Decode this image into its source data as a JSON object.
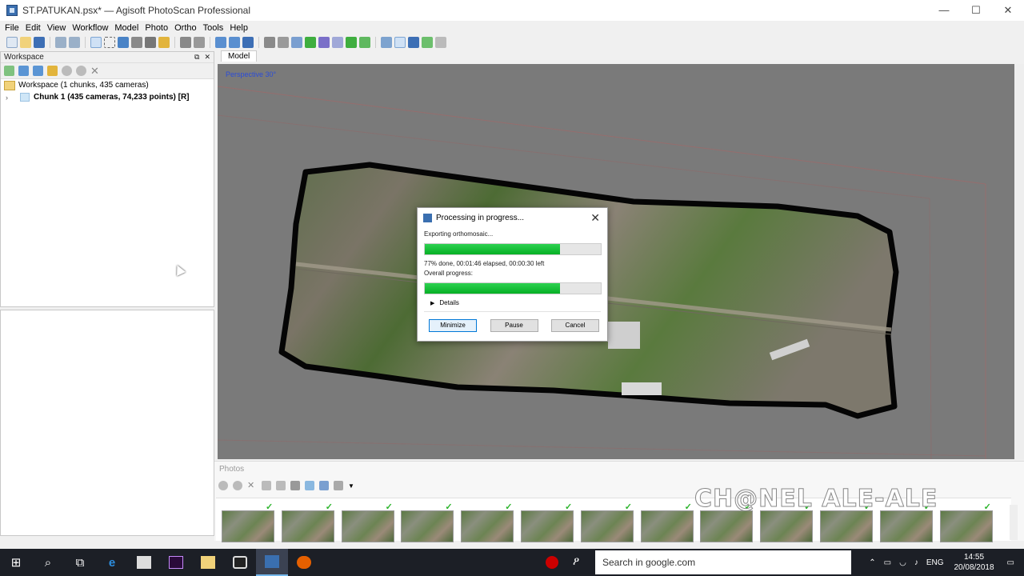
{
  "window": {
    "title": "ST.PATUKAN.psx* — Agisoft PhotoScan Professional",
    "minimize": "—",
    "maximize": "☐",
    "close": "✕"
  },
  "menu": [
    "File",
    "Edit",
    "View",
    "Workflow",
    "Model",
    "Photo",
    "Ortho",
    "Tools",
    "Help"
  ],
  "workspace": {
    "title": "Workspace",
    "tree_root": "Workspace (1 chunks, 435 cameras)",
    "chunk": "Chunk 1 (435 cameras, 74,233 points) [R]"
  },
  "model": {
    "tab": "Model",
    "view_label": "Perspective 30°"
  },
  "dialog": {
    "title": "Processing in progress...",
    "task_label": "Exporting orthomosaic...",
    "task_progress": 0.77,
    "status": "77% done, 00:01:46 elapsed, 00:00:30 left",
    "overall_label": "Overall progress:",
    "overall_progress": 0.77,
    "details": "Details",
    "buttons": {
      "minimize": "Minimize",
      "pause": "Pause",
      "cancel": "Cancel"
    }
  },
  "photos": {
    "title": "Photos",
    "thumb_count": 13
  },
  "watermark": "CH@NEL ALE-ALE",
  "taskbar": {
    "search_placeholder": "Search in google.com",
    "language": "ENG",
    "time": "14:55",
    "date": "20/08/2018"
  },
  "colors": {
    "progress": "#06b025",
    "viewport": "#7a7a7a",
    "taskbar": "#1c1f26"
  }
}
